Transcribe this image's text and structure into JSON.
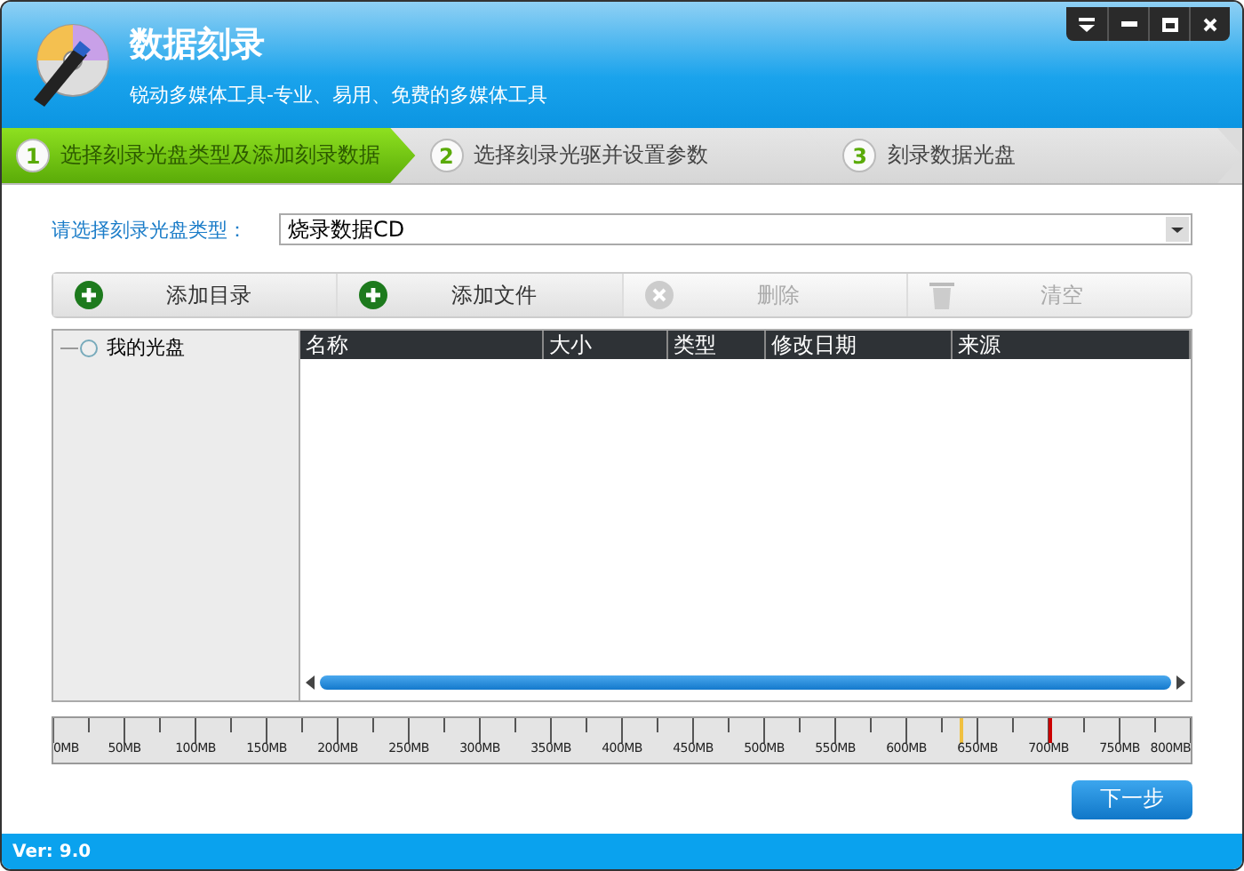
{
  "window": {
    "title": "数据刻录",
    "subtitle": "锐动多媒体工具-专业、易用、免费的多媒体工具"
  },
  "steps": [
    {
      "number": "1",
      "label": "选择刻录光盘类型及添加刻录数据",
      "selected": true
    },
    {
      "number": "2",
      "label": "选择刻录光驱并设置参数",
      "selected": false
    },
    {
      "number": "3",
      "label": "刻录数据光盘",
      "selected": false
    }
  ],
  "disc_type": {
    "label": "请选择刻录光盘类型：",
    "value": "烧录数据CD"
  },
  "toolbar": [
    {
      "kind": "add",
      "label": "添加目录",
      "disabled": false
    },
    {
      "kind": "add",
      "label": "添加文件",
      "disabled": false
    },
    {
      "kind": "delete",
      "label": "删除",
      "disabled": true
    },
    {
      "kind": "clear",
      "label": "清空",
      "disabled": true
    }
  ],
  "tree": {
    "items": [
      {
        "label": "我的光盘"
      }
    ]
  },
  "table": {
    "columns": [
      "名称",
      "大小",
      "类型",
      "修改日期",
      "来源"
    ]
  },
  "ruler": {
    "labels": [
      "0MB",
      "50MB",
      "100MB",
      "150MB",
      "200MB",
      "250MB",
      "300MB",
      "350MB",
      "400MB",
      "450MB",
      "500MB",
      "550MB",
      "600MB",
      "650MB",
      "700MB",
      "750MB",
      "800MB"
    ],
    "markers": [
      {
        "color": "#f0c040",
        "level": 0.797
      },
      {
        "color": "#cc0000",
        "level": 0.875
      }
    ]
  },
  "next_button": {
    "label": "下一步"
  },
  "status_bar": {
    "version": "Ver: 9.0"
  }
}
